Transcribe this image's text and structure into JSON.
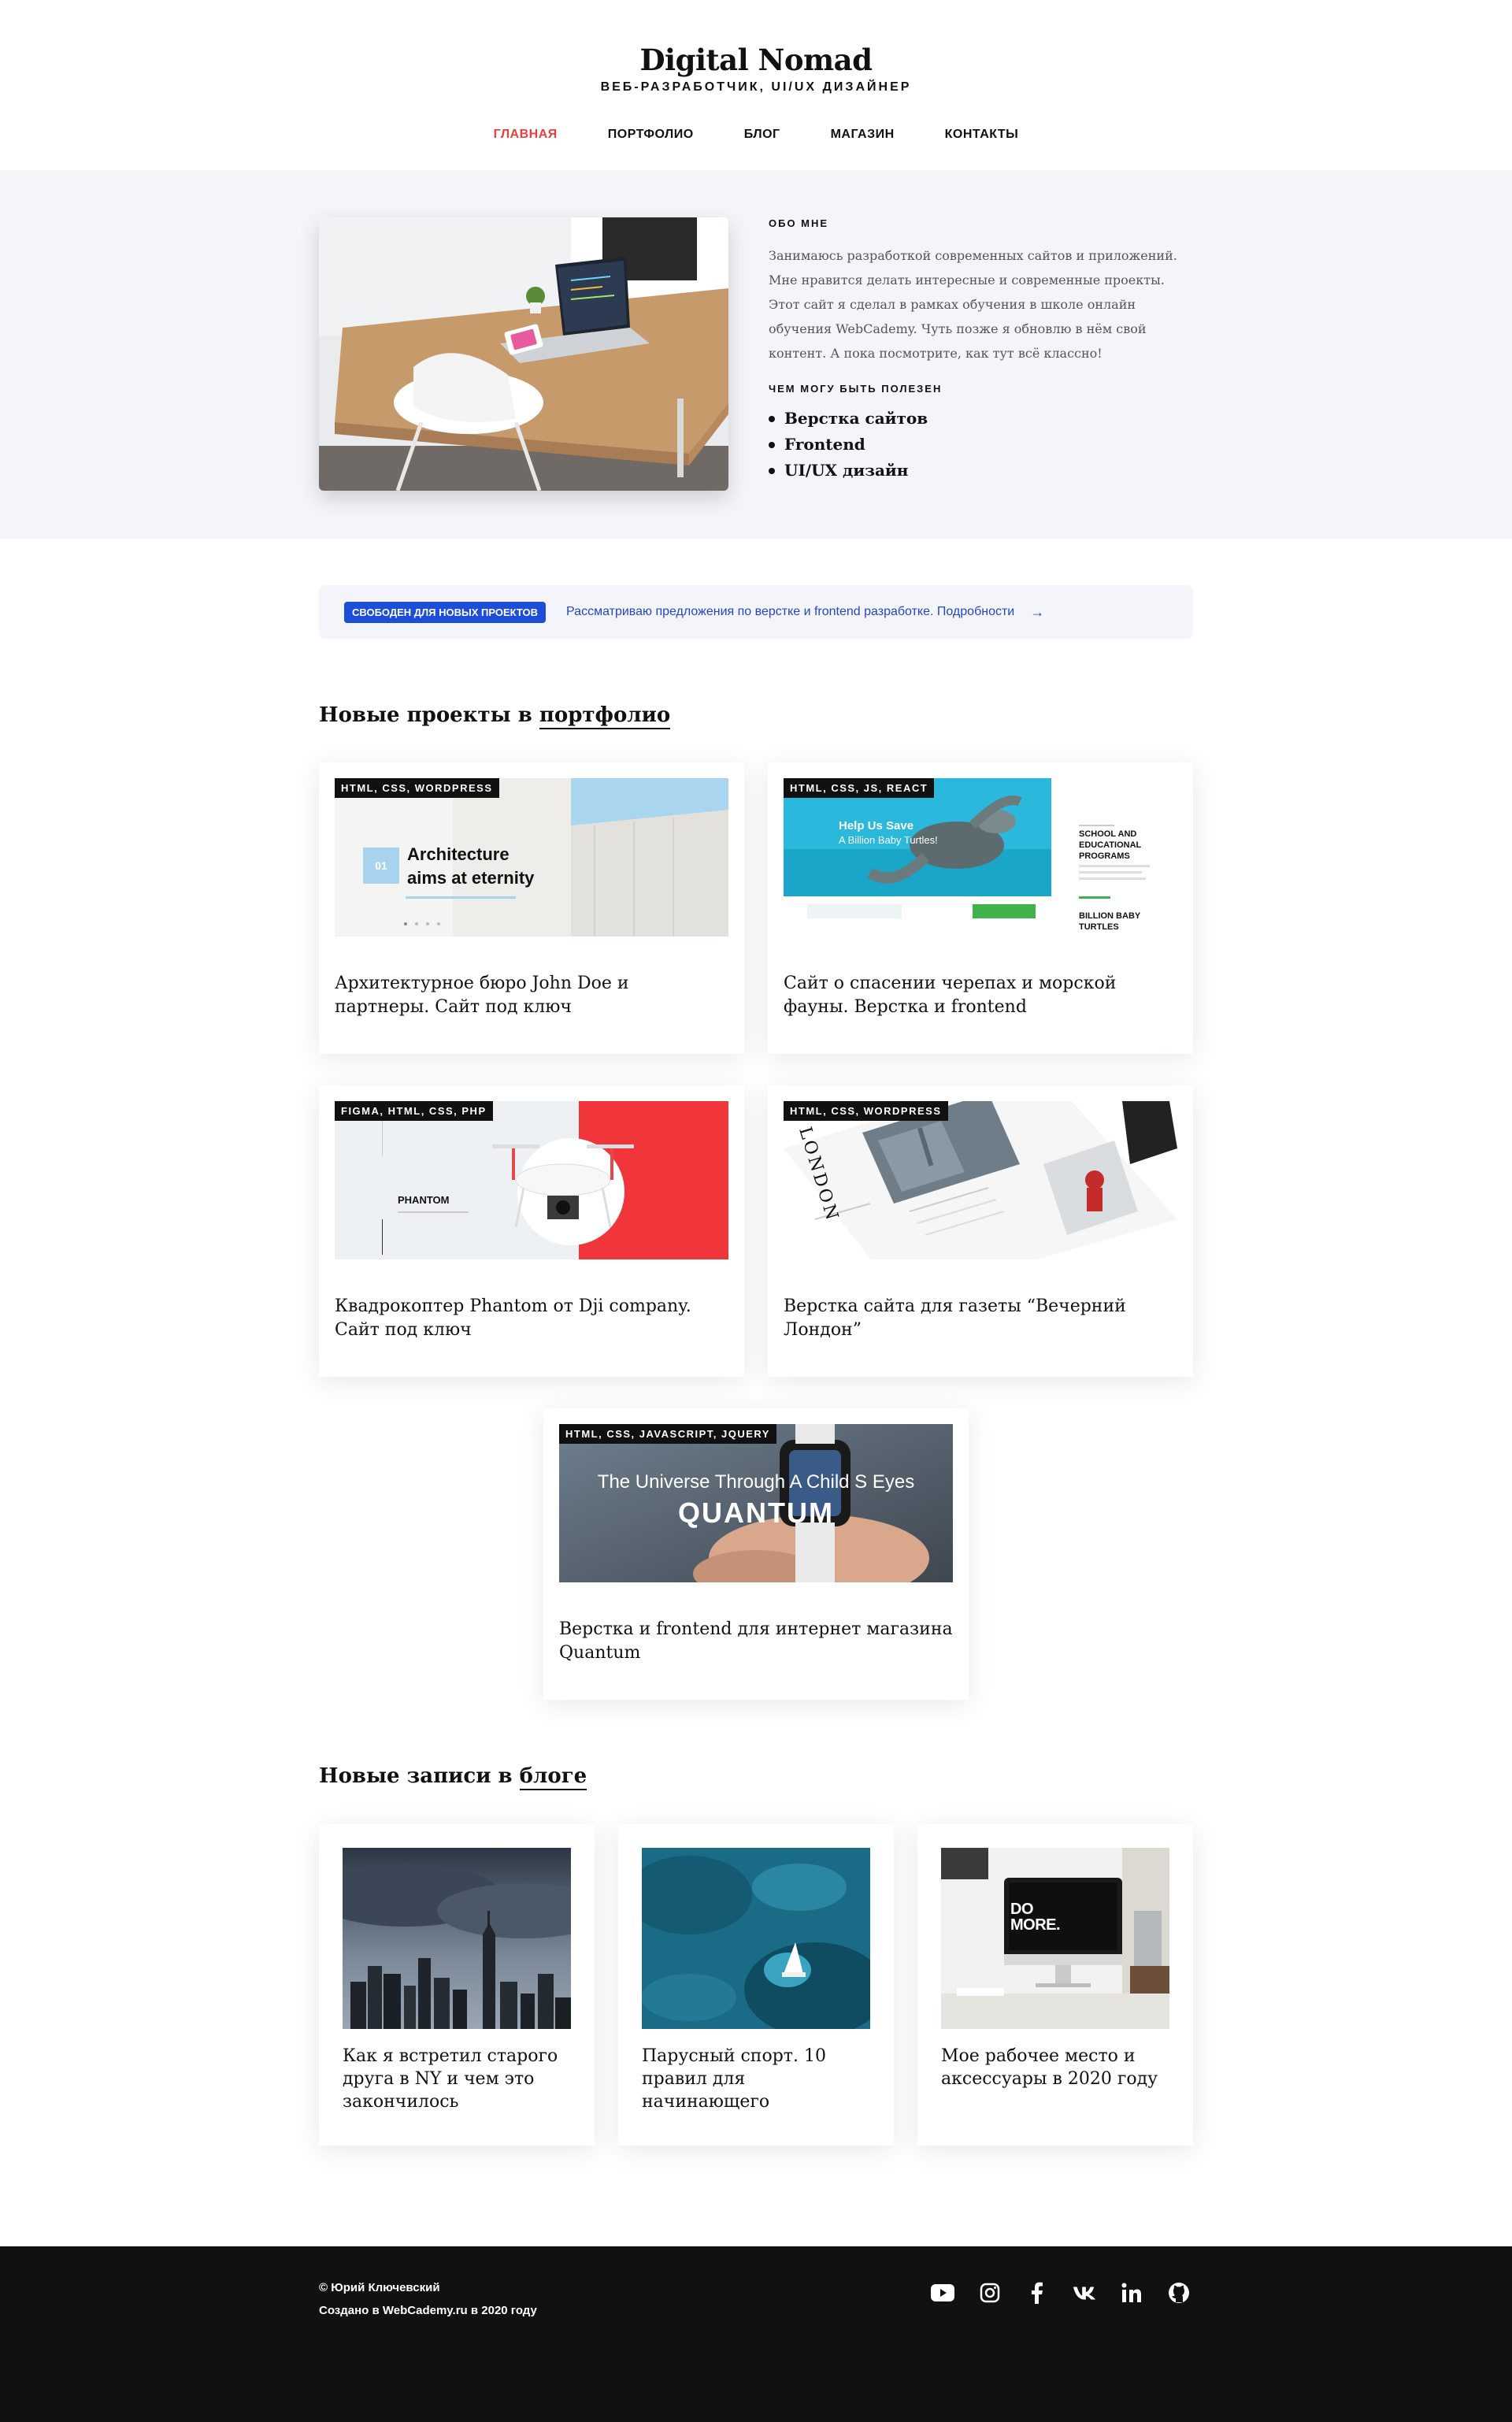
{
  "header": {
    "title": "Digital Nomad",
    "subtitle": "ВЕБ-РАЗРАБОТЧИК, UI/UX ДИЗАЙНЕР",
    "nav": [
      {
        "label": "ГЛАВНАЯ",
        "active": true
      },
      {
        "label": "ПОРТФОЛИО",
        "active": false
      },
      {
        "label": "БЛОГ",
        "active": false
      },
      {
        "label": "МАГАЗИН",
        "active": false
      },
      {
        "label": "КОНТАКТЫ",
        "active": false
      }
    ]
  },
  "about": {
    "heading": "ОБО МНЕ",
    "text": "Занимаюсь разработкой современных сайтов и приложений. Мне нравится делать интересные и современные проекты. Этот сайт я сделал в рамках обучения в школе онлайн обучения WebCademy. Чуть позже я обновлю в нём свой контент. А пока посмотрите, как тут всё классно!",
    "skills_heading": "ЧЕМ МОГУ БЫТЬ ПОЛЕЗЕН",
    "skills": [
      "Верстка сайтов",
      "Frontend",
      "UI/UX дизайн"
    ]
  },
  "banner": {
    "badge": "СВОБОДЕН ДЛЯ НОВЫХ ПРОЕКТОВ",
    "text": "Рассматриваю предложения по верстке и frontend разработке. Подробности",
    "arrow": "→"
  },
  "portfolio": {
    "title_prefix": "Новые проекты в ",
    "title_link": "портфолио",
    "items": [
      {
        "tag": "HTML, CSS, WORDPRESS",
        "title": "Архитектурное бюро John Doe и партнеры. Сайт под ключ",
        "preview": {
          "number": "01",
          "headline_1": "Architecture",
          "headline_2": "aims at eternity"
        }
      },
      {
        "tag": "HTML, CSS, JS, REACT",
        "title": "Сайт о спасении черепах и морской фауны. Верстка и frontend",
        "preview": {
          "headline_1": "Help Us Save",
          "headline_2": "A Billion Baby Turtles!",
          "side_title": "SCHOOL AND EDUCATIONAL PROGRAMS",
          "side_title_2": "BILLION BABY TURTLES"
        }
      },
      {
        "tag": "FIGMA, HTML, CSS, PHP",
        "title": "Квадрокоптер Phantom от Dji company. Сайт под ключ",
        "preview": {
          "headline": "PHANTOM"
        }
      },
      {
        "tag": "HTML, CSS, WORDPRESS",
        "title": "Верстка сайта для газеты “Вечерний Лондон”",
        "preview": {
          "headline": "LONDON"
        }
      },
      {
        "tag": "HTML, CSS, JAVASCRIPT, JQUERY",
        "title": "Верстка и frontend для интернет магазина Quantum",
        "preview": {
          "headline": "The Universe Through A Child S Eyes",
          "brand": "QUANTUM"
        }
      }
    ]
  },
  "blog": {
    "title_prefix": "Новые записи в ",
    "title_link": "блоге",
    "items": [
      {
        "title": "Как я встретил старого друга в NY и чем это закончилось"
      },
      {
        "title": "Парусный спорт. 10 правил для начинающего"
      },
      {
        "title": "Мое рабочее место и аксессуары в 2020 году",
        "preview_text": "DO MORE."
      }
    ]
  },
  "footer": {
    "copyright": "© Юрий Ключевский",
    "created": "Создано в WebCademy.ru в 2020 году",
    "socials": [
      "youtube-icon",
      "instagram-icon",
      "facebook-icon",
      "vk-icon",
      "linkedin-icon",
      "github-icon"
    ]
  },
  "colors": {
    "accent": "#e8413c",
    "badge": "#1d4ed8",
    "footer": "#111111",
    "about_bg": "#f4f5f9"
  }
}
